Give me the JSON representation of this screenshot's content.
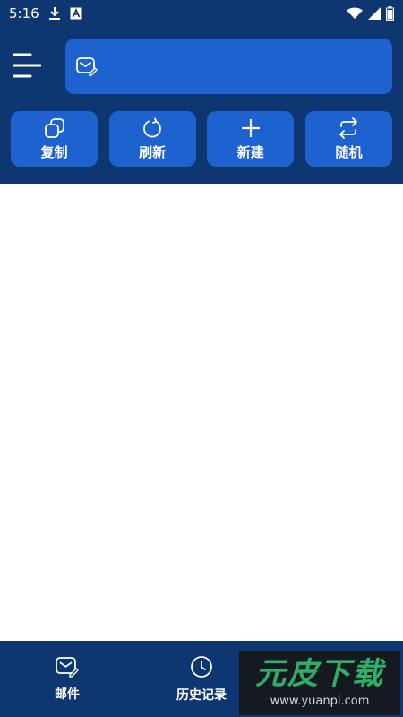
{
  "status_bar": {
    "time": "5:16",
    "icons": [
      "download-icon",
      "font-icon",
      "wifi-icon",
      "signal-icon",
      "battery-icon"
    ]
  },
  "header": {
    "search": {
      "value": "",
      "placeholder": ""
    },
    "actions": [
      {
        "label": "复制",
        "icon": "copy-icon"
      },
      {
        "label": "刷新",
        "icon": "refresh-icon"
      },
      {
        "label": "新建",
        "icon": "plus-icon"
      },
      {
        "label": "随机",
        "icon": "swap-icon"
      }
    ]
  },
  "bottom_nav": {
    "items": [
      {
        "label": "邮件",
        "icon": "mail-edit-icon"
      },
      {
        "label": "历史记录",
        "icon": "clock-icon"
      },
      {
        "label": "",
        "icon": "settings-icon"
      }
    ]
  },
  "watermark": {
    "logo": "元皮下载",
    "url": "www.yuanpi.com"
  },
  "colors": {
    "header_bg": "#0e3670",
    "button_bg": "#1e62cf",
    "content_bg": "#ffffff"
  }
}
